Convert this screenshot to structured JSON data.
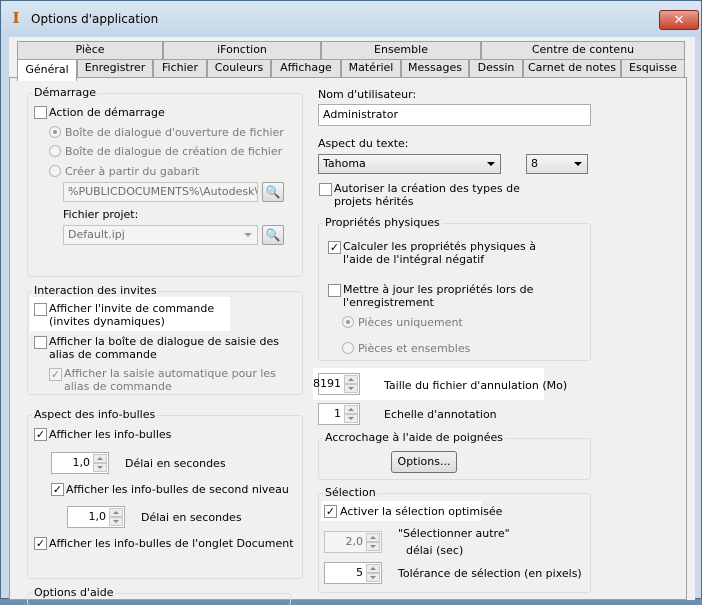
{
  "window": {
    "title": "Options d'application",
    "close_glyph": "✕",
    "app_icon_glyph": "I"
  },
  "tabs_row1": [
    "Pièce",
    "iFonction",
    "Ensemble",
    "Centre de contenu"
  ],
  "tabs_row2": [
    "Général",
    "Enregistrer",
    "Fichier",
    "Couleurs",
    "Affichage",
    "Matériel",
    "Messages",
    "Dessin",
    "Carnet de notes",
    "Esquisse"
  ],
  "startup": {
    "title": "Démarrage",
    "action": "Action de démarrage",
    "open_dialog": "Boîte de dialogue d'ouverture de fichier",
    "create_dialog": "Boîte de dialogue de création de fichier",
    "from_template": "Créer à partir du gabarit",
    "template_path": "%PUBLICDOCUMENTS%\\Autodesk\\Inv",
    "project_label": "Fichier projet:",
    "project_value": "Default.ipj"
  },
  "prompts": {
    "title": "Interaction des invites",
    "cmd_prompt": "Afficher l'invite de commande (invites dynamiques)",
    "alias_dialog": "Afficher la boîte de dialogue de saisie des alias de commande",
    "auto_complete": "Afficher la saisie automatique pour les alias de commande"
  },
  "tooltips": {
    "title": "Aspect des info-bulles",
    "show": "Afficher les info-bulles",
    "delay1": "1,0",
    "delay_label": "Délai en secondes",
    "second_level": "Afficher les info-bulles de second niveau",
    "delay2": "1,0",
    "doc_tab": "Afficher les info-bulles de l'onglet Document"
  },
  "help": {
    "title": "Options d'aide"
  },
  "user": {
    "label": "Nom d'utilisateur:",
    "value": "Administrator"
  },
  "text": {
    "label": "Aspect du texte:",
    "font": "Tahoma",
    "size": "8",
    "legacy": "Autoriser la création des types de projets hérités"
  },
  "physical": {
    "title": "Propriétés physiques",
    "negative_integral": "Calculer les propriétés physiques à l'aide de l'intégral négatif",
    "update_on_save": "Mettre à jour les propriétés lors de l'enregistrement",
    "parts_only": "Pièces uniquement",
    "parts_assemblies": "Pièces et ensembles"
  },
  "undo": {
    "value": "8191",
    "label": "Taille du fichier d'annulation (Mo)"
  },
  "annotation": {
    "value": "1",
    "label": "Echelle d'annotation"
  },
  "grips": {
    "title": "Accrochage à l'aide de poignées",
    "options_btn": "Options..."
  },
  "selection": {
    "title": "Sélection",
    "optimized": "Activer la sélection optimisée",
    "select_other_value": "2,0",
    "select_other_label": "\"Sélectionner autre\"",
    "select_other_delay": "délai (sec)",
    "tolerance_value": "5",
    "tolerance_label": "Tolérance de sélection (en pixels)"
  },
  "icons": {
    "browse": "folder-search-icon",
    "check": "✓"
  },
  "colors": {
    "accent_title": "#c9d9ea",
    "close_red": "#c8402c",
    "highlight": "#ffffff"
  }
}
